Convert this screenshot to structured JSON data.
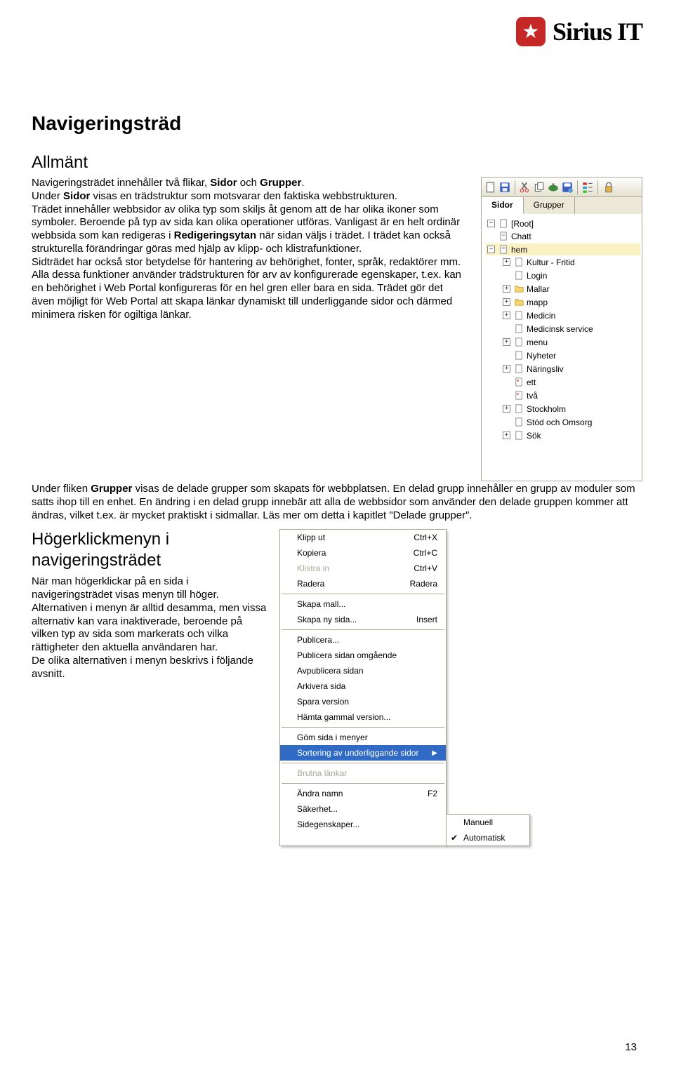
{
  "logo": {
    "text": "Sirius IT"
  },
  "h1": "Navigeringsträd",
  "section1_h2": "Allmänt",
  "para1": "Navigeringsträdet innehåller två flikar, <b>Sidor</b> och <b>Grupper</b>.<br>Under <b>Sidor</b> visas en trädstruktur som motsvarar den faktiska webbstrukturen.<br>Trädet innehåller webbsidor av olika typ som skiljs åt genom att de har olika ikoner som symboler. Beroende på typ av sida kan olika operationer utföras. Vanligast är en helt ordinär webbsida som kan redigeras i <b>Redigeringsytan</b> när sidan väljs i trädet. I trädet kan också strukturella förändringar göras med hjälp av klipp- och klistrafunktioner.<br>Sidträdet har också stor betydelse för hantering av behörighet, fonter, språk, redaktörer mm. Alla dessa funktioner använder trädstrukturen för arv av konfigurerade egenskaper, t.ex. kan en behörighet i Web Portal konfigureras för en hel gren eller bara en sida. Trädet gör det även möjligt för Web Portal att skapa länkar dynamiskt till underliggande sidor och därmed minimera risken för ogiltiga länkar.",
  "para2": "Under fliken <b>Grupper</b> visas de delade grupper som skapats för webbplatsen. En delad grupp innehåller en grupp av moduler som satts ihop till en enhet. En ändring i en delad grupp innebär att alla de webbsidor som använder den delade gruppen kommer att ändras, vilket t.ex. är mycket praktiskt i sidmallar. Läs mer om detta i kapitlet \"Delade grupper\".",
  "section2_h2": "Högerklickmenyn i navigeringsträdet",
  "para3": "När man högerklickar på en sida i navigeringsträdet visas menyn till höger. Alternativen i menyn är alltid desamma, men vissa alternativ kan vara inaktiverade, beroende på vilken typ av sida som markerats och vilka rättigheter den aktuella användaren har.<br>De olika alternativen i menyn beskrivs i följande avsnitt.",
  "tabs": {
    "sidor": "Sidor",
    "grupper": "Grupper"
  },
  "tree": {
    "root": "[Root]",
    "chatt": "Chatt",
    "hem": "hem",
    "kultur": "Kultur - Fritid",
    "login": "Login",
    "mallar": "Mallar",
    "mapp": "mapp",
    "medicin": "Medicin",
    "medserv": "Medicinsk service",
    "menu": "menu",
    "nyheter": "Nyheter",
    "naringsliv": "Näringsliv",
    "ett": "ett",
    "tva": "två",
    "stockholm": "Stockholm",
    "stod": "Stöd och Omsorg",
    "sok": "Sök"
  },
  "menu": {
    "klippUt": {
      "label": "Klipp ut",
      "shortcut": "Ctrl+X"
    },
    "kopiera": {
      "label": "Kopiera",
      "shortcut": "Ctrl+C"
    },
    "klistraIn": {
      "label": "Klistra in",
      "shortcut": "Ctrl+V"
    },
    "radera": {
      "label": "Radera",
      "shortcut": "Radera"
    },
    "skapaMall": "Skapa mall...",
    "skapaNySida": {
      "label": "Skapa ny sida...",
      "shortcut": "Insert"
    },
    "publicera": "Publicera...",
    "publiceraOmg": "Publicera sidan omgående",
    "avpublicera": "Avpublicera sidan",
    "arkivera": "Arkivera sida",
    "sparaVersion": "Spara version",
    "hamtaGammal": "Hämta gammal version...",
    "gomSida": "Göm sida i menyer",
    "sortering": "Sortering av underliggande sidor",
    "brutnaLankar": "Brutna länkar",
    "andraNamn": {
      "label": "Ändra namn",
      "shortcut": "F2"
    },
    "sakerhet": "Säkerhet...",
    "sidegenskaper": "Sidegenskaper...",
    "manuell": "Manuell",
    "automatisk": "Automatisk"
  },
  "pagenum": "13"
}
